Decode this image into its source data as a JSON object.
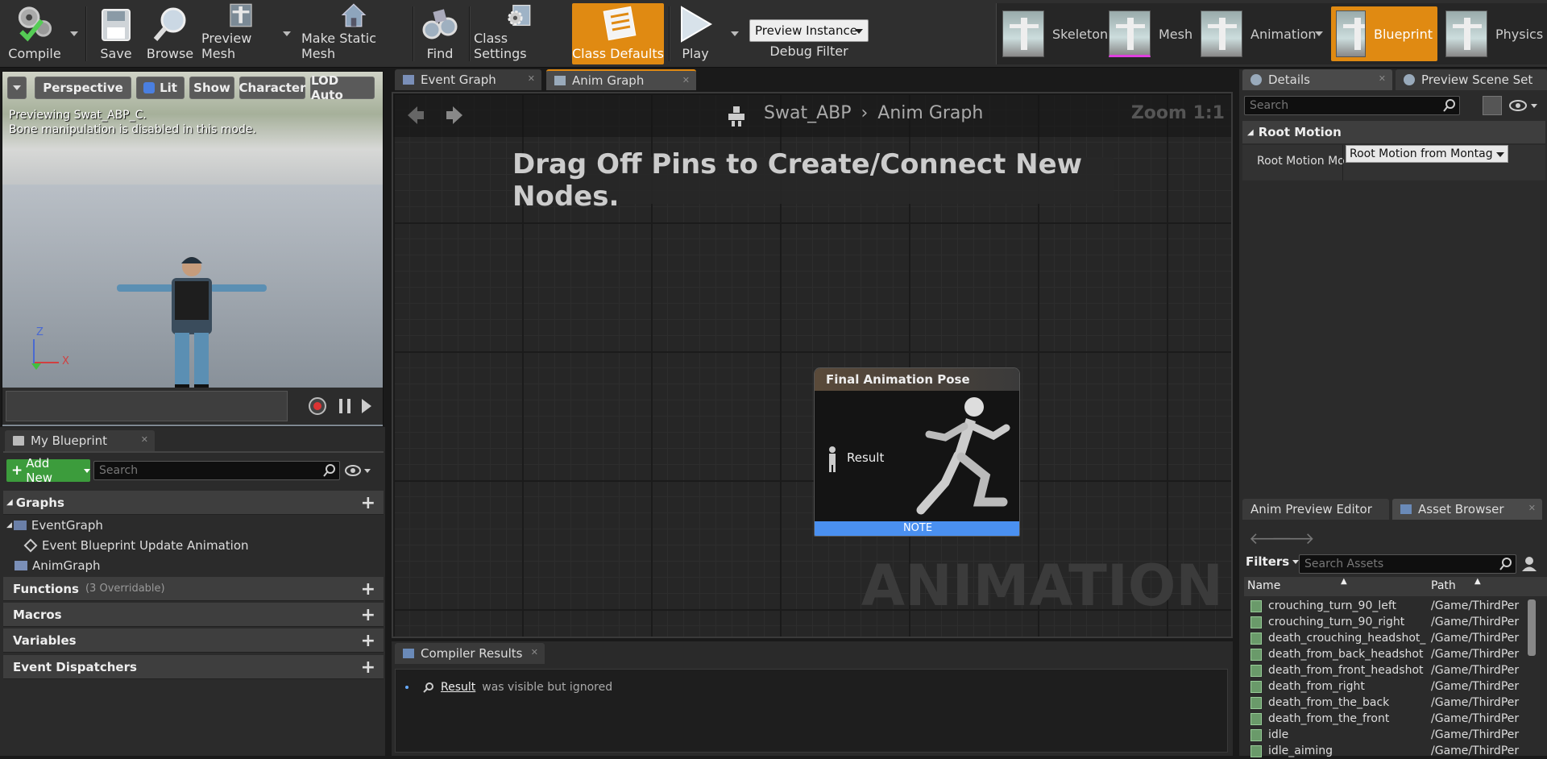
{
  "toolbar": {
    "compile": "Compile",
    "save": "Save",
    "browse": "Browse",
    "preview_mesh": "Preview Mesh",
    "make_static_mesh": "Make Static Mesh",
    "find": "Find",
    "class_settings": "Class Settings",
    "class_defaults": "Class Defaults",
    "play": "Play",
    "preview_instance": "Preview Instance",
    "debug_filter": "Debug Filter"
  },
  "modes": {
    "skeleton": "Skeleton",
    "mesh": "Mesh",
    "animation": "Animation",
    "blueprint": "Blueprint",
    "physics": "Physics"
  },
  "viewport": {
    "perspective": "Perspective",
    "lit": "Lit",
    "show": "Show",
    "character": "Character",
    "lod": "LOD Auto",
    "info_line1": "Previewing Swat_ABP_C.",
    "info_line2": "Bone manipulation is disabled in this mode.",
    "axis_z": "Z",
    "axis_x": "X"
  },
  "my_blueprint": {
    "tab": "My Blueprint",
    "add_new": "Add New",
    "search_placeholder": "Search",
    "graphs": "Graphs",
    "event_graph": "EventGraph",
    "event_update": "Event Blueprint Update Animation",
    "anim_graph": "AnimGraph",
    "functions": "Functions",
    "functions_note": "(3 Overridable)",
    "macros": "Macros",
    "variables": "Variables",
    "dispatchers": "Event Dispatchers"
  },
  "graph": {
    "tab_event": "Event Graph",
    "tab_anim": "Anim Graph",
    "breadcrumb_root": "Swat_ABP",
    "breadcrumb_current": "Anim Graph",
    "zoom": "Zoom 1:1",
    "hint": "Drag Off Pins to Create/Connect New Nodes.",
    "watermark": "ANIMATION",
    "node_title": "Final Animation Pose",
    "node_pin": "Result",
    "node_footer": "NOTE"
  },
  "compiler": {
    "tab": "Compiler Results",
    "result_link": "Result",
    "result_text": "was visible but ignored"
  },
  "details": {
    "tab": "Details",
    "tab2": "Preview Scene Set",
    "search_placeholder": "Search",
    "category": "Root Motion",
    "prop_label": "Root Motion Mo",
    "prop_value": "Root Motion from Montag"
  },
  "assets": {
    "tab1": "Anim Preview Editor",
    "tab2": "Asset Browser",
    "filters": "Filters",
    "search_placeholder": "Search Assets",
    "col_name": "Name",
    "col_path": "Path",
    "rows": [
      {
        "name": "crouching_turn_90_left",
        "path": "/Game/ThirdPer"
      },
      {
        "name": "crouching_turn_90_right",
        "path": "/Game/ThirdPer"
      },
      {
        "name": "death_crouching_headshot_",
        "path": "/Game/ThirdPer"
      },
      {
        "name": "death_from_back_headshot",
        "path": "/Game/ThirdPer"
      },
      {
        "name": "death_from_front_headshot",
        "path": "/Game/ThirdPer"
      },
      {
        "name": "death_from_right",
        "path": "/Game/ThirdPer"
      },
      {
        "name": "death_from_the_back",
        "path": "/Game/ThirdPer"
      },
      {
        "name": "death_from_the_front",
        "path": "/Game/ThirdPer"
      },
      {
        "name": "idle",
        "path": "/Game/ThirdPer"
      },
      {
        "name": "idle_aiming",
        "path": "/Game/ThirdPer"
      }
    ]
  },
  "colors": {
    "accent_orange": "#e08a12",
    "note_blue": "#4a90f0",
    "add_green": "#3c9c3c"
  }
}
